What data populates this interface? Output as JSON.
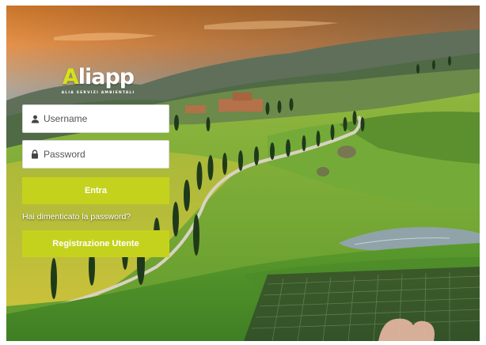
{
  "brand": {
    "name_accent": "A",
    "name_rest": "liapp",
    "tagline": "ALIA SERVIZI AMBIENTALI",
    "accent_color": "#c5d21d"
  },
  "login": {
    "username_placeholder": "Username",
    "username_icon": "user-icon",
    "password_placeholder": "Password",
    "password_icon": "lock-icon",
    "submit_label": "Entra",
    "forgot_label": "Hai dimenticato la password?",
    "register_label": "Registrazione Utente"
  }
}
